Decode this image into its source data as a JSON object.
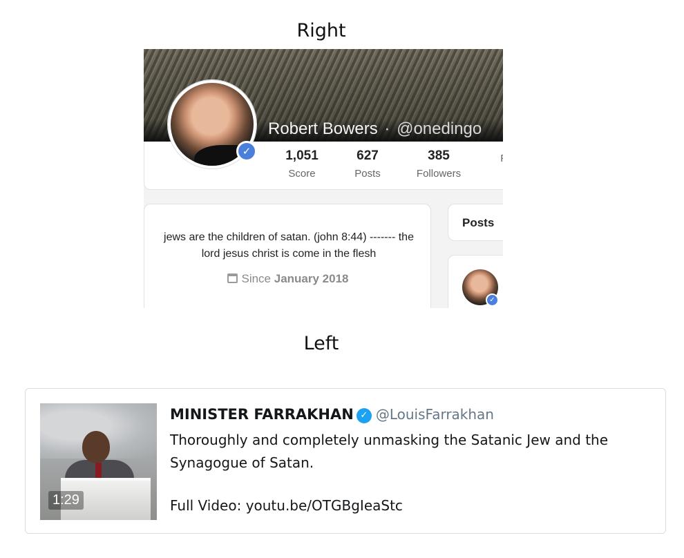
{
  "captions": {
    "top": "Right",
    "bottom": "Left"
  },
  "profile": {
    "name": "Robert Bowers",
    "separator": "·",
    "handle": "@onedingo",
    "stats": [
      {
        "value": "1,051",
        "label": "Score"
      },
      {
        "value": "627",
        "label": "Posts"
      },
      {
        "value": "385",
        "label": "Followers"
      },
      {
        "value": "",
        "label": "Fo"
      }
    ],
    "bio": "jews are the children of satan. (john 8:44) ------- the lord jesus christ is come in the flesh",
    "since_prefix": "Since",
    "since_date": "January 2018",
    "posts_tab": "Posts",
    "verified_icon": "✓"
  },
  "tweet": {
    "display_name": "MINISTER FARRAKHAN",
    "verified_icon": "✓",
    "handle": "@LouisFarrakhan",
    "text": "Thoroughly and completely unmasking the Satanic Jew and the Synagogue of Satan.",
    "link": "Full Video: youtu.be/OTGBgIeaStc",
    "video_duration": "1:29"
  },
  "colors": {
    "verified_profile": "#4a7fdc",
    "verified_tweet": "#1da1f2",
    "handle_gray": "#657786"
  }
}
